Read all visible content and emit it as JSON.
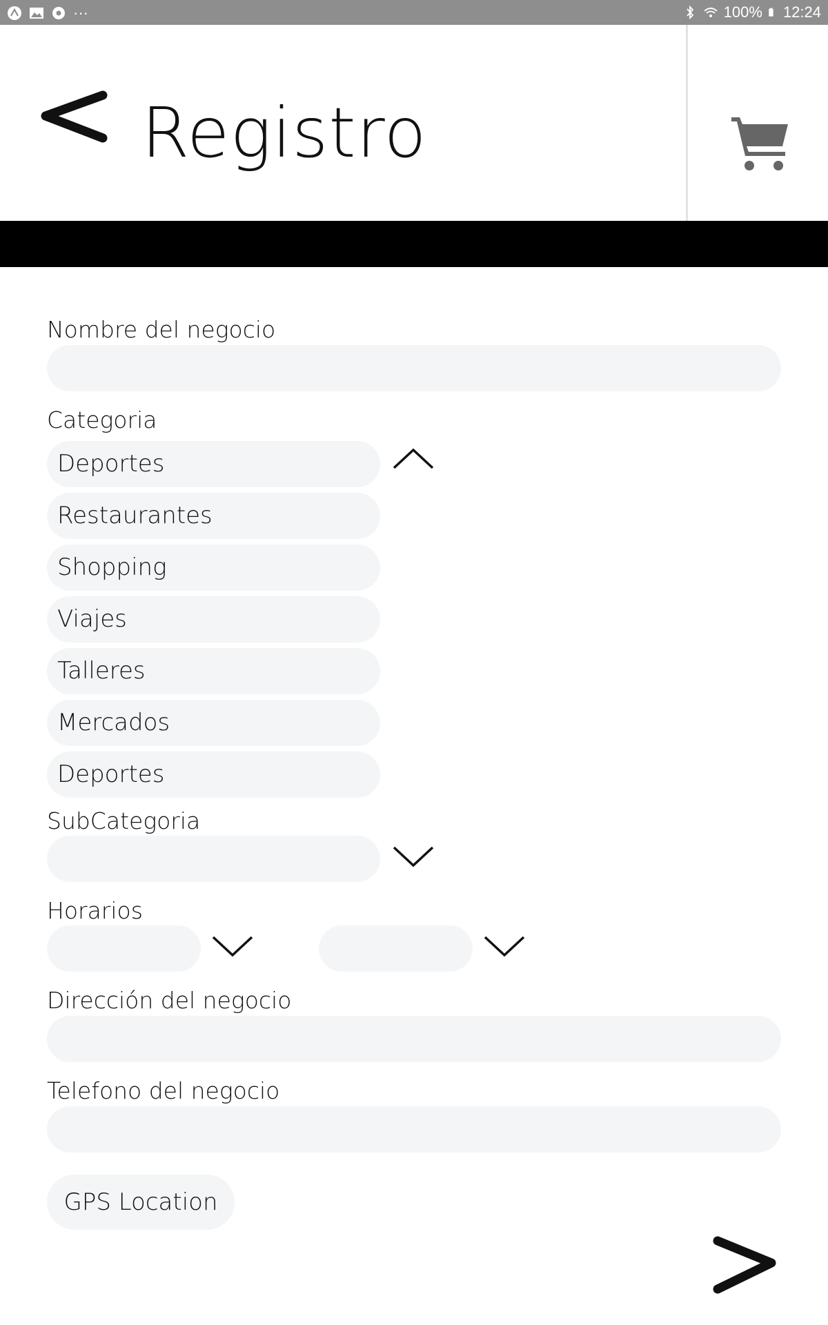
{
  "status_bar": {
    "battery": "100%",
    "time": "12:24",
    "left_icons": [
      "app-icon",
      "gallery-icon",
      "settings-icon",
      "more-icon"
    ],
    "right_icons": [
      "bluetooth-icon",
      "wifi-icon",
      "battery-icon"
    ]
  },
  "header": {
    "title": "Registro",
    "back_icon": "chevron-left-icon",
    "cart_icon": "cart-icon"
  },
  "form": {
    "business_name": {
      "label": "Nombre del negocio",
      "value": ""
    },
    "category": {
      "label": "Categoria",
      "selected": "Deportes",
      "expanded": true,
      "options": [
        "Restaurantes",
        "Shopping",
        "Viajes",
        "Talleres",
        "Mercados",
        "Deportes"
      ]
    },
    "subcategory": {
      "label": "SubCategoria",
      "value": ""
    },
    "hours": {
      "label": "Horarios",
      "open": "",
      "close": ""
    },
    "address": {
      "label": "Dirección del negocio",
      "value": ""
    },
    "phone": {
      "label": "Telefono del negocio",
      "value": ""
    },
    "gps_button": "GPS Location"
  },
  "colors": {
    "status_bar": "#8e8e8e",
    "band": "#000000",
    "field_bg": "#f4f5f6",
    "cart": "#666666"
  }
}
